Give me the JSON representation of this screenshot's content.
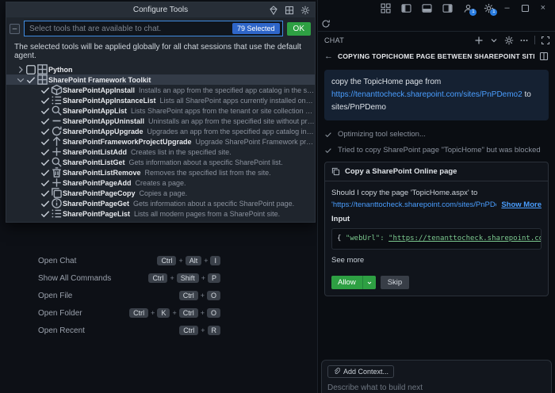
{
  "dialog": {
    "title": "Configure Tools",
    "search": {
      "placeholder": "Select tools that are available to chat.",
      "badge": "79 Selected",
      "ok_label": "OK",
      "tristate": "–"
    },
    "description": "The selected tools will be applied globally for all chat sessions that use the default agent.",
    "tree": [
      {
        "kind": "group",
        "label": "Python",
        "icon": "grid",
        "twisty": "chevron-right",
        "checked": false,
        "selected": false
      },
      {
        "kind": "group",
        "label": "SharePoint Framework Toolkit",
        "icon": "grid",
        "twisty": "chevron-down",
        "checked": true,
        "selected": true
      },
      {
        "kind": "tool",
        "name": "SharePointAppInstall",
        "icon": "package",
        "desc": "Installs an app from the specified app catalog in the site."
      },
      {
        "kind": "tool",
        "name": "SharePointAppInstanceList",
        "icon": "list",
        "desc": "Lists all SharePoint apps currently installed on the specified site."
      },
      {
        "kind": "tool",
        "name": "SharePointAppList",
        "icon": "search",
        "desc": "Lists SharePoint apps from the tenant or site collection app catalog."
      },
      {
        "kind": "tool",
        "name": "SharePointAppUninstall",
        "icon": "minus",
        "desc": "Uninstalls an app from the specified site without prompting for confir..."
      },
      {
        "kind": "tool",
        "name": "SharePointAppUpgrade",
        "icon": "sync",
        "desc": "Upgrades an app from the specified app catalog in the site."
      },
      {
        "kind": "tool",
        "name": "SharePointFrameworkProjectUpgrade",
        "icon": "arrow-up",
        "desc": "Upgrade SharePoint Framework project."
      },
      {
        "kind": "tool",
        "name": "SharePointListAdd",
        "icon": "plus",
        "desc": "Creates list in the specified site."
      },
      {
        "kind": "tool",
        "name": "SharePointListGet",
        "icon": "search",
        "desc": "Gets information about a specific SharePoint list."
      },
      {
        "kind": "tool",
        "name": "SharePointListRemove",
        "icon": "trash",
        "desc": "Removes the specified list from the site."
      },
      {
        "kind": "tool",
        "name": "SharePointPageAdd",
        "icon": "plus",
        "desc": "Creates a page."
      },
      {
        "kind": "tool",
        "name": "SharePointPageCopy",
        "icon": "copy",
        "desc": "Copies a page."
      },
      {
        "kind": "tool",
        "name": "SharePointPageGet",
        "icon": "info",
        "desc": "Gets information about a specific SharePoint page."
      },
      {
        "kind": "tool",
        "name": "SharePointPageList",
        "icon": "list",
        "desc": "Lists all modern pages from a SharePoint site."
      }
    ]
  },
  "editor": {
    "shortcuts": [
      {
        "label": "Open Chat",
        "keys": [
          "Ctrl",
          "Alt",
          "I"
        ]
      },
      {
        "label": "Show All Commands",
        "keys": [
          "Ctrl",
          "Shift",
          "P"
        ]
      },
      {
        "label": "Open File",
        "keys": [
          "Ctrl",
          "O"
        ]
      },
      {
        "label": "Open Folder",
        "keys": [
          "Ctrl",
          "K",
          "Ctrl",
          "O"
        ]
      },
      {
        "label": "Open Recent",
        "keys": [
          "Ctrl",
          "R"
        ]
      }
    ]
  },
  "window": {
    "account_badge": "1",
    "gear_badge": "1"
  },
  "chat": {
    "panel_title": "CHAT",
    "session_title": "COPYING TOPICHOME PAGE BETWEEN SHAREPOINT SITES",
    "user_message": {
      "text1": "copy the TopicHome page from",
      "link": "https://tenanttocheck.sharepoint.com/sites/PnPDemo2",
      "text2": "to",
      "text3": "sites/PnPDemo"
    },
    "status": [
      "Optimizing tool selection...",
      "Tried to copy SharePoint page \"TopicHome\" but was blocked"
    ],
    "tool_card": {
      "title": "Copy a SharePoint Online page",
      "question_line1": "Should I copy the page 'TopicHome.aspx' to",
      "question_url": "'https://tenanttocheck.sharepoint.com/sites/PnPDemo/SitePa",
      "show_more": "Show More",
      "input_label": "Input",
      "code_open": "{ ",
      "code_key": "\"webUrl\": ",
      "code_value": "\"https://tenanttocheck.sharepoint.com/sit",
      "see_more": "See more",
      "allow_label": "Allow",
      "skip_label": "Skip"
    },
    "input": {
      "add_context": "Add Context...",
      "placeholder": "Describe what to build next"
    },
    "colors": {
      "accent_blue": "#4a9eff",
      "ok_green": "#2ea043",
      "badge_blue": "#2f66c9"
    }
  }
}
